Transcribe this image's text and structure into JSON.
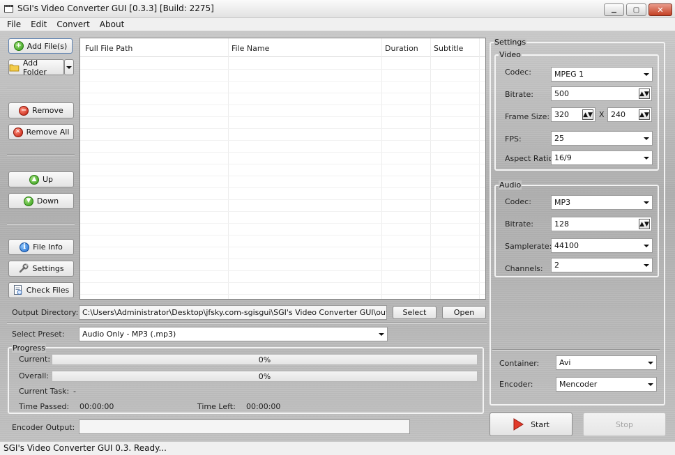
{
  "window": {
    "title": "SGI's Video Converter GUI [0.3.3] [Build: 2275]",
    "minimize_glyph": "▁",
    "maximize_glyph": "▢",
    "close_glyph": "✕"
  },
  "menu": [
    "File",
    "Edit",
    "Convert",
    "About"
  ],
  "left_toolbar": {
    "add_files": "Add File(s)",
    "add_folder": "Add Folder",
    "remove": "Remove",
    "remove_all": "Remove All",
    "up": "Up",
    "down": "Down",
    "file_info": "File Info",
    "settings": "Settings",
    "check_files": "Check Files"
  },
  "file_list": {
    "columns": [
      "Full File Path",
      "File Name",
      "Duration",
      "Subtitle"
    ],
    "rows": []
  },
  "output": {
    "label": "Output Directory:",
    "path": "C:\\Users\\Administrator\\Desktop\\jfsky.com-sgisgui\\SGI's Video Converter GUI\\outputs",
    "select_button": "Select",
    "open_button": "Open"
  },
  "preset": {
    "label": "Select Preset:",
    "value": "Audio Only - MP3 (.mp3)"
  },
  "progress": {
    "group_title": "Progress",
    "current_label": "Current:",
    "current_text": "0%",
    "current_value": 0,
    "overall_label": "Overall:",
    "overall_text": "0%",
    "overall_value": 0,
    "task_label": "Current Task:",
    "task_value": "-",
    "time_passed_label": "Time Passed:",
    "time_passed": "00:00:00",
    "time_left_label": "Time Left:",
    "time_left": "00:00:00"
  },
  "encoder_output": {
    "label": "Encoder Output:",
    "value": ""
  },
  "settings": {
    "title": "Settings",
    "video": {
      "title": "Video",
      "codec_label": "Codec:",
      "codec": "MPEG 1",
      "bitrate_label": "Bitrate:",
      "bitrate": "500",
      "frame_size_label": "Frame Size:",
      "width": "320",
      "separator": "X",
      "height": "240",
      "fps_label": "FPS:",
      "fps": "25",
      "aspect_label": "Aspect Ratio:",
      "aspect": "16/9"
    },
    "audio": {
      "title": "Audio",
      "codec_label": "Codec:",
      "codec": "MP3",
      "bitrate_label": "Bitrate:",
      "bitrate": "128",
      "samplerate_label": "Samplerate:",
      "samplerate": "44100",
      "channels_label": "Channels:",
      "channels": "2"
    },
    "container_label": "Container:",
    "container": "Avi",
    "encoder_label": "Encoder:",
    "encoder": "Mencoder"
  },
  "actions": {
    "start": "Start",
    "stop": "Stop"
  },
  "status": {
    "text": "SGI's Video Converter GUI 0.3. Ready..."
  },
  "colors": {
    "accent_green": "#2f9a13",
    "accent_red": "#c01a0a",
    "accent_blue": "#1a66c9",
    "start_icon": "#e23a2a"
  },
  "icons": {
    "add_files": "plus-icon",
    "add_folder": "folder-icon",
    "remove": "minus-icon",
    "remove_all": "x-icon",
    "up": "arrow-up-icon",
    "down": "arrow-down-icon",
    "file_info": "info-icon",
    "settings": "wrench-icon",
    "check_files": "document-check-icon",
    "start": "play-icon"
  }
}
